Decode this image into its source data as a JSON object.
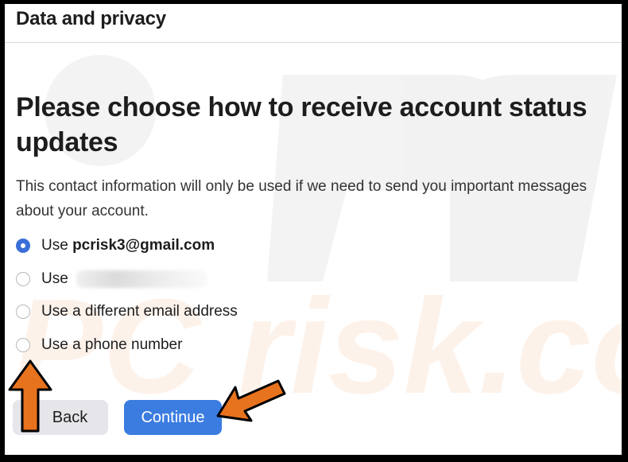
{
  "header": {
    "title": "Data and privacy"
  },
  "main": {
    "heading": "Please choose how to receive account status updates",
    "description": "This contact information will only be used if we need to send you important messages about your account.",
    "options": [
      {
        "prefix": "Use",
        "value": "pcrisk3@gmail.com",
        "checked": true
      },
      {
        "prefix": "Use",
        "value": "",
        "blurred": true,
        "checked": false
      },
      {
        "prefix": "Use a different email address",
        "checked": false
      },
      {
        "prefix": "Use a phone number",
        "checked": false
      }
    ],
    "buttons": {
      "back": "Back",
      "continue": "Continue"
    }
  },
  "colors": {
    "accent": "#3b7ce0",
    "annotation_arrow": "#e8731e"
  },
  "watermark": {
    "text": "PC risk.com"
  }
}
